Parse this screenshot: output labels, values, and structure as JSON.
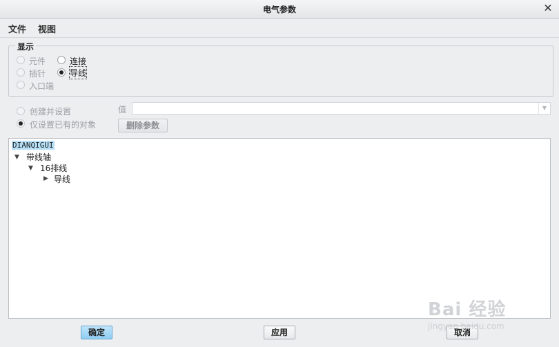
{
  "window": {
    "title": "电气参数",
    "close_glyph": "✕"
  },
  "menu": {
    "items": [
      "文件",
      "视图"
    ]
  },
  "display_group": {
    "legend": "显示",
    "options": [
      {
        "label": "元件",
        "enabled": false,
        "checked": false
      },
      {
        "label": "连接",
        "enabled": true,
        "checked": false
      },
      {
        "label": "插针",
        "enabled": false,
        "checked": false
      },
      {
        "label": "导线",
        "enabled": true,
        "checked": true
      },
      {
        "label": "入口端",
        "enabled": false,
        "checked": false
      }
    ]
  },
  "mode": {
    "options": [
      {
        "label": "创建并设置",
        "enabled": false,
        "checked": false
      },
      {
        "label": "仅设置已有的对象",
        "enabled": false,
        "checked": true
      }
    ]
  },
  "value_field": {
    "label": "值",
    "value": "",
    "arrow_glyph": "▼"
  },
  "delete_button": {
    "label": "删除参数"
  },
  "tree": {
    "nodes": [
      {
        "label": "DIANQIGUI",
        "selected": true,
        "twisty": ""
      },
      {
        "label": "带线轴",
        "twisty": "▼"
      },
      {
        "label": "16排线",
        "twisty": "▼"
      },
      {
        "label": "导线",
        "twisty": "▶"
      }
    ]
  },
  "footer": {
    "ok": "确定",
    "apply": "应用",
    "cancel": "取消"
  },
  "watermark": {
    "text": "Bai 经验",
    "url": "jingyan.baidu.com"
  }
}
